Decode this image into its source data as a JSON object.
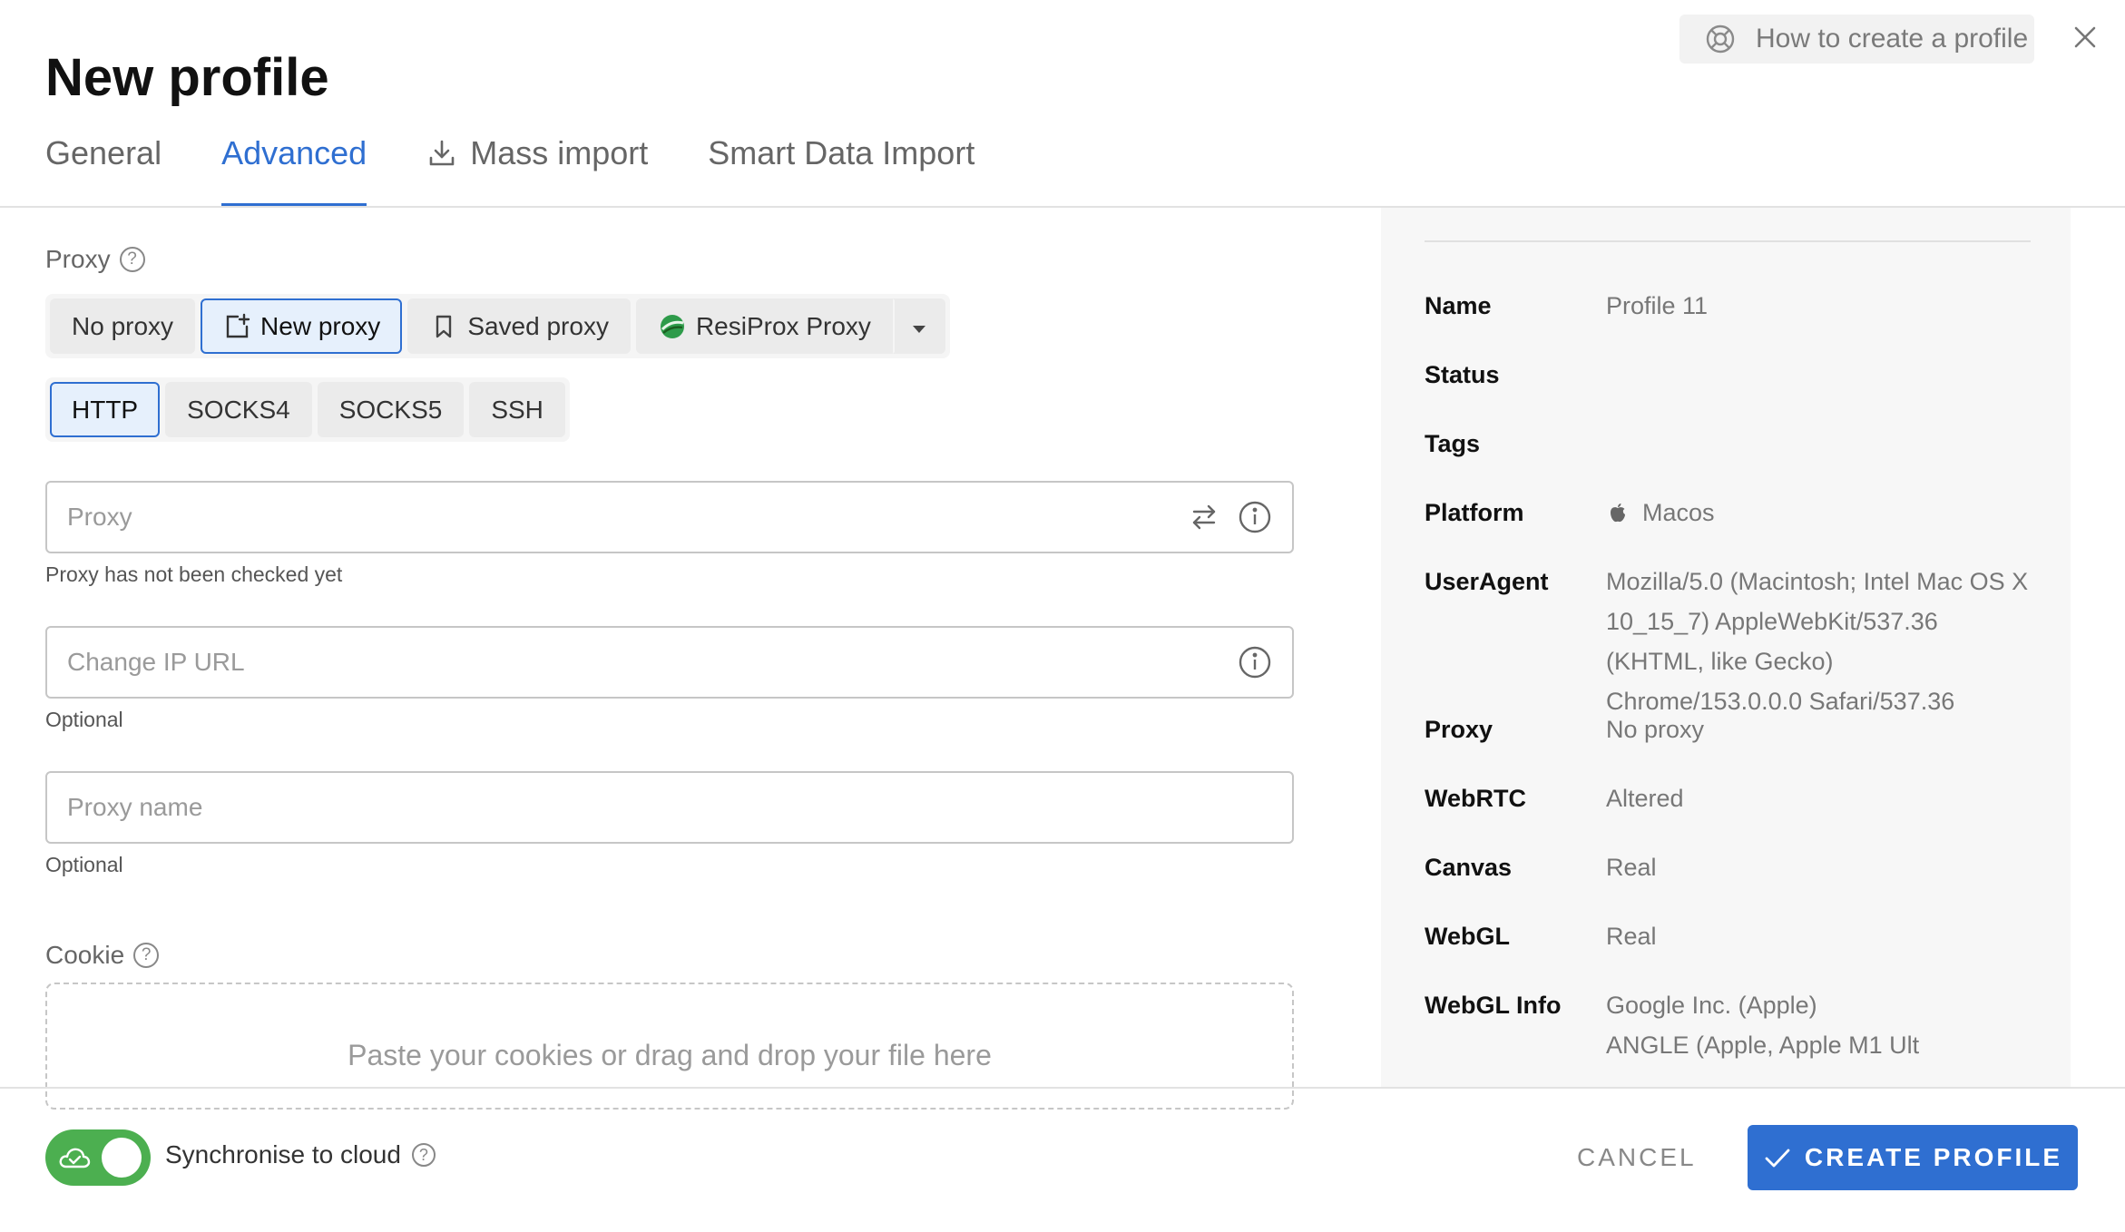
{
  "header": {
    "title": "New profile",
    "help_label": "How to create a profile"
  },
  "tabs": [
    {
      "label": "General",
      "active": false
    },
    {
      "label": "Advanced",
      "active": true
    },
    {
      "label": "Mass import",
      "active": false,
      "icon": "download-icon"
    },
    {
      "label": "Smart Data Import",
      "active": false
    }
  ],
  "proxy": {
    "section_label": "Proxy",
    "modes": [
      "No proxy",
      "New proxy",
      "Saved proxy",
      "ResiProx Proxy"
    ],
    "active_mode": "New proxy",
    "types": [
      "HTTP",
      "SOCKS4",
      "SOCKS5",
      "SSH"
    ],
    "active_type": "HTTP",
    "proxy_field": {
      "placeholder": "Proxy",
      "value": "",
      "hint": "Proxy has not been checked yet"
    },
    "change_ip_field": {
      "placeholder": "Change IP URL",
      "value": "",
      "hint": "Optional"
    },
    "proxy_name_field": {
      "placeholder": "Proxy name",
      "value": "",
      "hint": "Optional"
    }
  },
  "cookie": {
    "section_label": "Cookie",
    "dropzone_text": "Paste your cookies or drag and drop your file here"
  },
  "summary": {
    "rows": [
      {
        "key": "Name",
        "value": "Profile 11"
      },
      {
        "key": "Status",
        "value": ""
      },
      {
        "key": "Tags",
        "value": ""
      },
      {
        "key": "Platform",
        "value": "Macos",
        "icon": "apple-icon"
      },
      {
        "key": "UserAgent",
        "value": "Mozilla/5.0 (Macintosh; Intel Mac OS X 10_15_7) AppleWebKit/537.36 (KHTML, like Gecko) Chrome/153.0.0.0 Safari/537.36"
      },
      {
        "key": "Proxy",
        "value": "No proxy"
      },
      {
        "key": "WebRTC",
        "value": "Altered"
      },
      {
        "key": "Canvas",
        "value": "Real"
      },
      {
        "key": "WebGL",
        "value": "Real"
      },
      {
        "key": "WebGL Info",
        "value": "Google Inc. (Apple)"
      },
      {
        "key": "",
        "value": "ANGLE (Apple, Apple M1 Ult"
      }
    ]
  },
  "footer": {
    "sync_label": "Synchronise to cloud",
    "sync_enabled": true,
    "cancel_label": "CANCEL",
    "create_label": "CREATE PROFILE"
  },
  "colors": {
    "accent": "#2f6fd1",
    "toggle_on": "#4caf50",
    "panel_bg": "#f7f7f7"
  }
}
